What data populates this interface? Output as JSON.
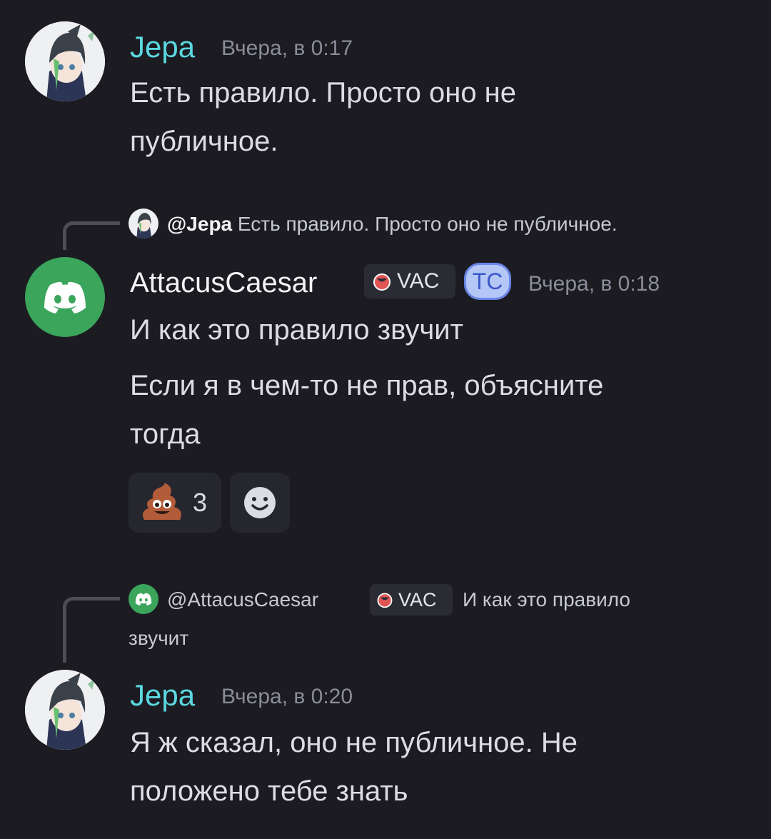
{
  "messages": [
    {
      "author": "Jepa",
      "timestamp": "Вчера, в 0:17",
      "lines": [
        "Есть правило. Просто оно не",
        "публичное."
      ]
    },
    {
      "reply": {
        "mention": "@Jepa",
        "text": "Есть правило. Просто оно не публичное."
      },
      "author": "AttacusCaesar",
      "tag": "VAC",
      "role_badge": "TC",
      "timestamp": "Вчера, в 0:18",
      "lines": [
        "И как это правило звучит"
      ],
      "lines2": [
        "Если я в чем-то не прав, объясните",
        "тогда"
      ],
      "reactions": [
        {
          "emoji": "poop-emoji",
          "count": "3"
        },
        {
          "emoji": "add-reaction-icon"
        }
      ]
    },
    {
      "reply": {
        "mention": "@AttacusCaesar",
        "tag": "VAC",
        "text_line1": "И как это правило",
        "text_line2": "звучит"
      },
      "author": "Jepa",
      "timestamp": "Вчера, в 0:20",
      "lines": [
        "Я ж сказал, оно не публичное. Не",
        "положено тебе знать"
      ]
    }
  ],
  "colors": {
    "background": "#1b1b21",
    "jepa_name": "#5bd7df",
    "discord_green": "#3ba55c",
    "tc_badge": "#b5c7f7"
  }
}
